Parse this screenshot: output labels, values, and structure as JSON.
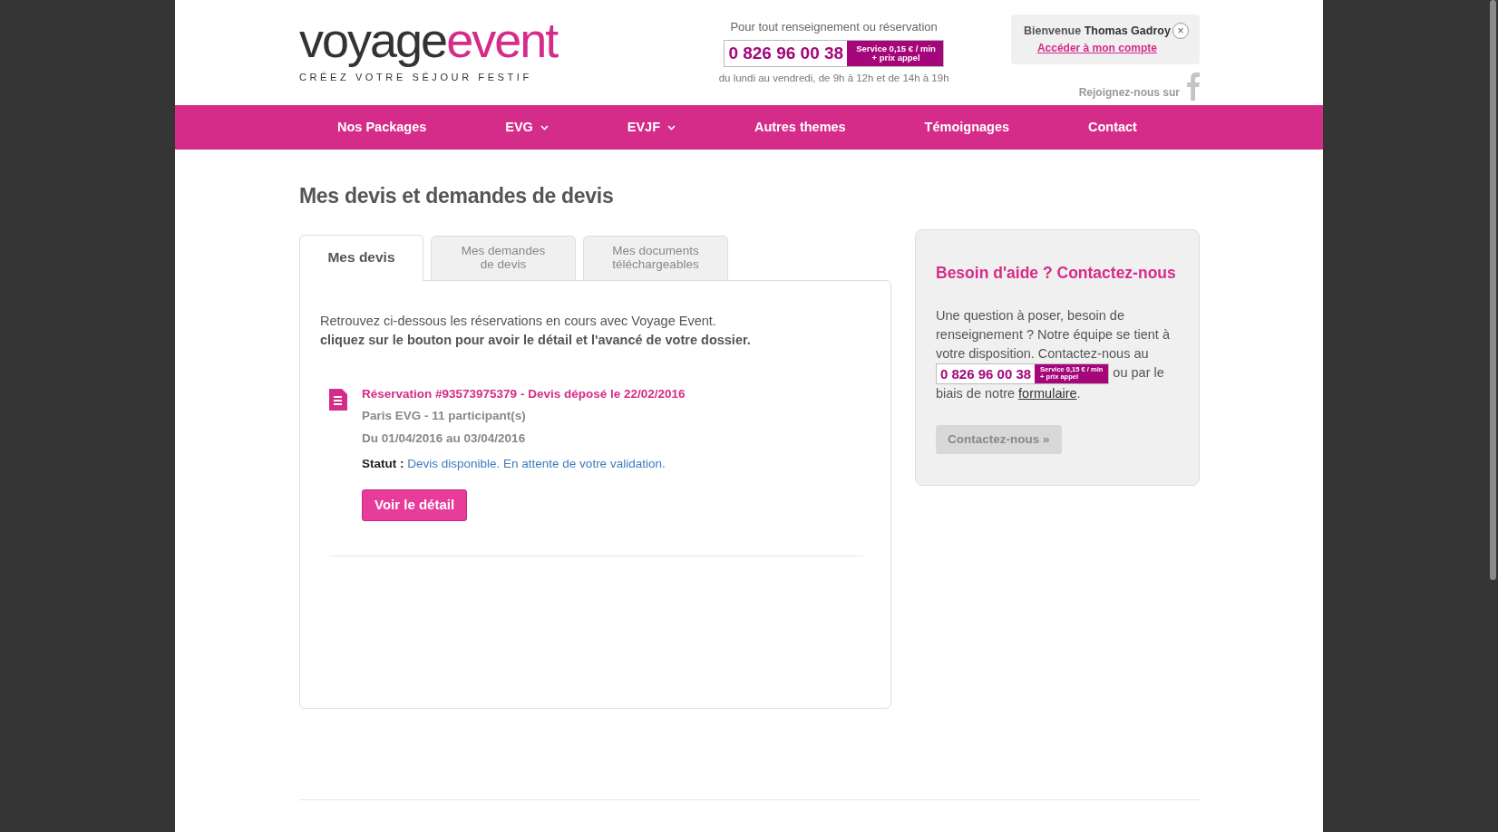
{
  "header": {
    "logo": {
      "wordmark_dark": "voyage",
      "wordmark_accent": "event",
      "tagline": "CRÉEZ VOTRE SÉJOUR FESTIF"
    },
    "hotline": {
      "intro": "Pour tout renseignement ou réservation",
      "number": "0 826 96 00 38",
      "rate_line_1": "Service 0,15 € / min",
      "rate_line_2": "+ prix appel",
      "hours": "du lundi au vendredi, de 9h à 12h et de 14h à 19h"
    },
    "welcome": {
      "greeting": "Bienvenue",
      "user": "Thomas Gadroy",
      "close": "×",
      "account_link": "Accéder à mon compte"
    },
    "social": {
      "label": "Rejoignez-nous sur"
    }
  },
  "nav": [
    {
      "label": "Nos Packages",
      "has_dropdown": false
    },
    {
      "label": "EVG",
      "has_dropdown": true
    },
    {
      "label": "EVJF",
      "has_dropdown": true
    },
    {
      "label": "Autres themes",
      "has_dropdown": false
    },
    {
      "label": "Témoignages",
      "has_dropdown": false
    },
    {
      "label": "Contact",
      "has_dropdown": false
    }
  ],
  "page_title": "Mes devis et demandes de devis",
  "tabs": [
    {
      "label": "Mes devis",
      "selected": true
    },
    {
      "label": "Mes demandes\nde devis",
      "selected": false
    },
    {
      "label": "Mes documents\ntéléchargeables",
      "selected": false
    }
  ],
  "intro": {
    "line_1": "Retrouvez ci-dessous les réservations en cours avec Voyage Event.",
    "line_2": "cliquez sur le bouton pour avoir le détail et l'avancé de votre dossier."
  },
  "reservations": [
    {
      "title": "Réservation #93573975379 - Devis déposé le 22/02/2016",
      "summary": "Paris EVG - 11 participant(s)",
      "dates": "Du 01/04/2016 au 03/04/2016",
      "status_label": "Statut :",
      "status": "Devis disponible. En attente de votre validation.",
      "button": "Voir le détail"
    }
  ],
  "help": {
    "title": "Besoin d'aide ? Contactez-nous",
    "text_before": "Une question à poser, besoin de renseignement ? Notre équipe se tient à votre disposition. Contactez-nous au",
    "number": "0 826 96 00 38",
    "rate_line_1": "Service 0,15 € / min",
    "rate_line_2": "+ prix appel",
    "text_middle": "ou par le biais de notre",
    "link": "formulaire",
    "text_after": ".",
    "button": "Contactez-nous »"
  }
}
